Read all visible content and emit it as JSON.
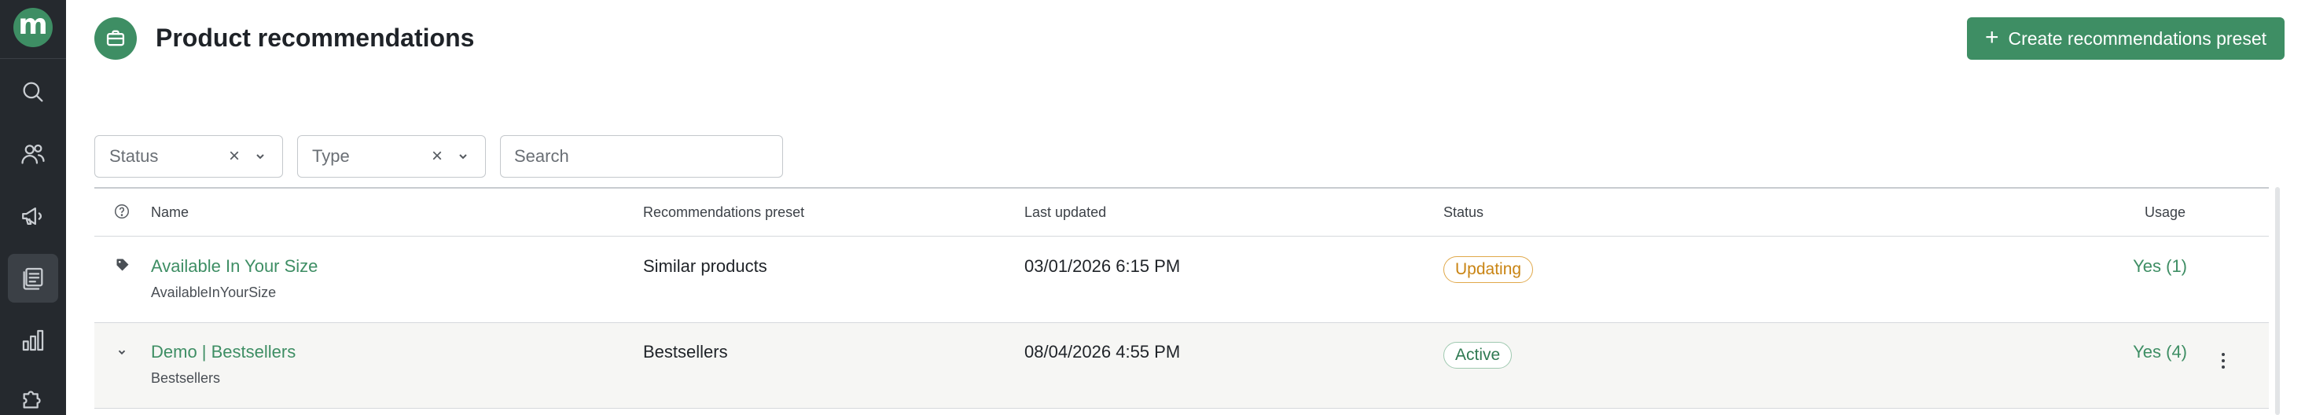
{
  "sidebar": {
    "logo_letter": "m",
    "items": [
      {
        "icon": "search-icon"
      },
      {
        "icon": "users-icon"
      },
      {
        "icon": "megaphone-icon"
      },
      {
        "icon": "recommendations-icon",
        "active": true
      },
      {
        "icon": "bar-chart-icon"
      },
      {
        "icon": "puzzle-icon"
      }
    ]
  },
  "header": {
    "title": "Product recommendations",
    "icon": "briefcase-icon",
    "create_button_label": "Create recommendations preset"
  },
  "filters": {
    "status_label": "Status",
    "type_label": "Type",
    "search_placeholder": "Search"
  },
  "table": {
    "columns": {
      "name": "Name",
      "preset": "Recommendations preset",
      "last_updated": "Last updated",
      "status": "Status",
      "usage": "Usage"
    },
    "rows": [
      {
        "name": "Available In Your Size",
        "id": "AvailableInYourSize",
        "preset": "Similar products",
        "last_updated": "03/01/2026 6:15 PM",
        "status": "Updating",
        "usage": "Yes (1)"
      },
      {
        "name": "Demo | Bestsellers",
        "id": "Bestsellers",
        "preset": "Bestsellers",
        "last_updated": "08/04/2026 4:55 PM",
        "status": "Active",
        "usage": "Yes (4)"
      }
    ]
  },
  "colors": {
    "brand": "#3e8e64",
    "sidebar_bg": "#25292e",
    "updating": "#c98413",
    "active": "#2f7a52"
  }
}
